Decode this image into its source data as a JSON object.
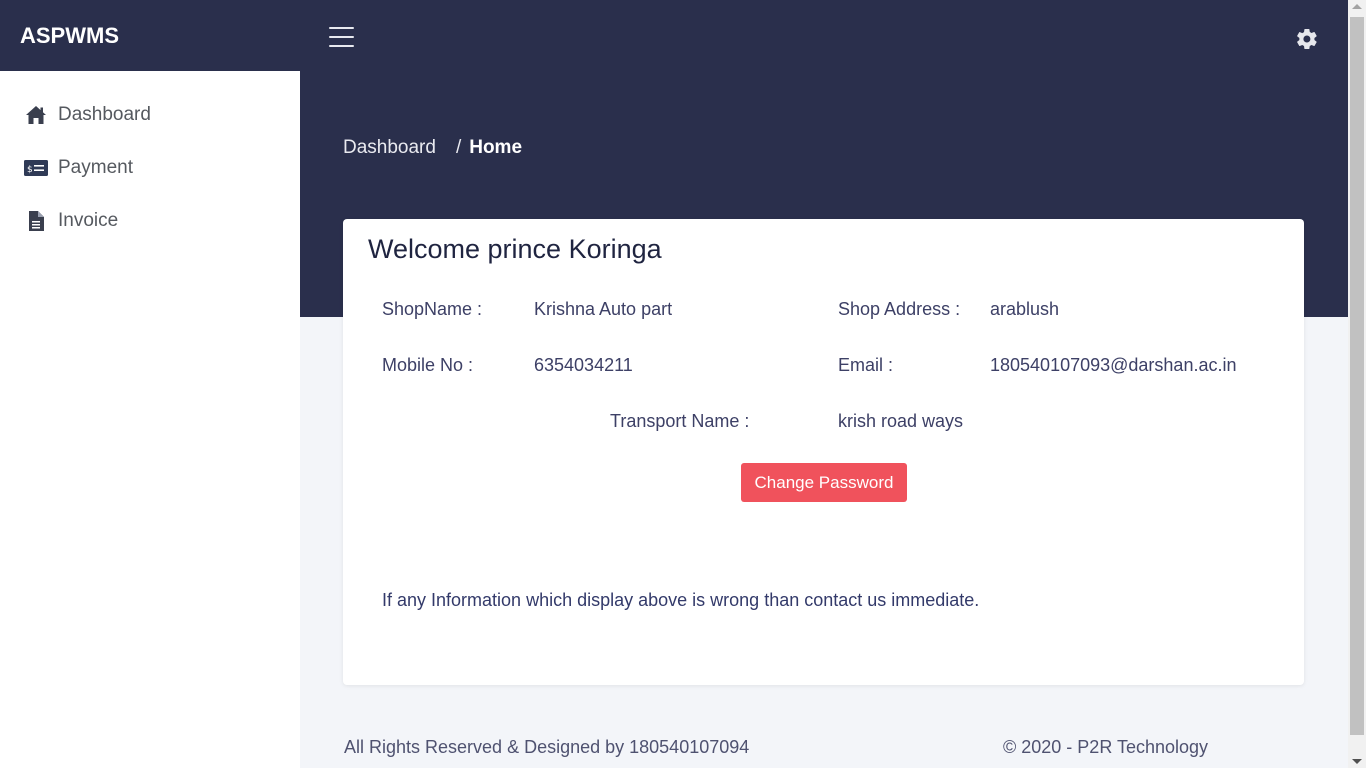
{
  "app": {
    "brand": "ASPWMS"
  },
  "sidebar": {
    "items": [
      {
        "label": "Dashboard",
        "icon": "home-icon"
      },
      {
        "label": "Payment",
        "icon": "money-bill-icon"
      },
      {
        "label": "Invoice",
        "icon": "file-icon"
      }
    ]
  },
  "header": {
    "menu_icon": "hamburger-icon",
    "settings_icon": "gear-icon"
  },
  "breadcrumb": {
    "parent": "Dashboard",
    "separator": "/",
    "current": "Home"
  },
  "profile": {
    "title": "Welcome prince Koringa",
    "shop_name_label": "ShopName :",
    "shop_name": "Krishna Auto part",
    "shop_address_label": "Shop Address :",
    "shop_address": "arablush",
    "mobile_label": "Mobile No :",
    "mobile": "6354034211",
    "email_label": "Email :",
    "email": "180540107093@darshan.ac.in",
    "transport_label": "Transport Name :",
    "transport": "krish road ways",
    "change_password_label": "Change Password",
    "notice": "If any Information which display above is wrong than contact us immediate."
  },
  "footer": {
    "left": "All Rights Reserved & Designed by 180540107094",
    "right": "© 2020 - P2R Technology"
  },
  "colors": {
    "header_bg": "#2a2f4c",
    "accent_button": "#f0525c",
    "page_bg": "#f3f5f9"
  }
}
